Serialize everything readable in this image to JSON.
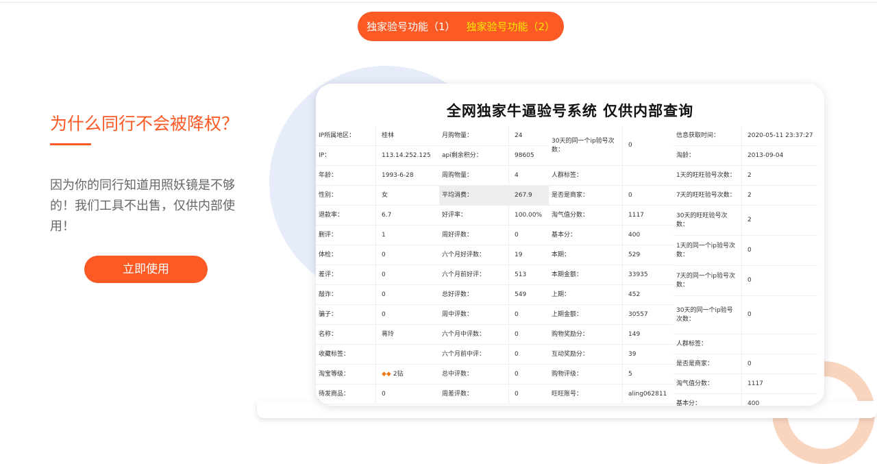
{
  "tabs": [
    {
      "label": "独家验号功能（1）"
    },
    {
      "label": "独家验号功能（2）"
    }
  ],
  "headline": "为什么同行不会被降权？",
  "description": "因为你的同行知道用照妖镜是不够的！我们工具不出售，仅供内部使用！",
  "cta": "立即使用",
  "card": {
    "title": "全网独家牛逼验号系统 仅供内部查询",
    "col1": [
      {
        "k": "IP所属地区：",
        "v": "桂林"
      },
      {
        "k": "IP：",
        "v": "113.14.252.125"
      },
      {
        "k": "年龄：",
        "v": "1993-6-28"
      },
      {
        "k": "性别：",
        "v": "女"
      },
      {
        "k": "退款率：",
        "v": "6.7"
      },
      {
        "k": "删评：",
        "v": "1"
      },
      {
        "k": "体检：",
        "v": "0"
      },
      {
        "k": "差评：",
        "v": "0"
      },
      {
        "k": "敲诈：",
        "v": "0"
      },
      {
        "k": "骗子：",
        "v": "0"
      },
      {
        "k": "名称：",
        "v": "蒋玲"
      },
      {
        "k": "收藏标签：",
        "v": ""
      },
      {
        "k": "淘宝等级：",
        "v": "2钻"
      },
      {
        "k": "待发商品：",
        "v": "0"
      }
    ],
    "col2": [
      {
        "k": "月购物量：",
        "v": "24"
      },
      {
        "k": "api剩余积分：",
        "v": "98605"
      },
      {
        "k": "周购物量：",
        "v": "4"
      },
      {
        "k": "平均消费：",
        "v": "267.9"
      },
      {
        "k": "好评率：",
        "v": "100.00%"
      },
      {
        "k": "周好评数：",
        "v": "0"
      },
      {
        "k": "六个月好评数：",
        "v": "19"
      },
      {
        "k": "六个月前好评：",
        "v": "513"
      },
      {
        "k": "总好评数：",
        "v": "549"
      },
      {
        "k": "周中评数：",
        "v": "0"
      },
      {
        "k": "六个月中评数：",
        "v": "0"
      },
      {
        "k": "六个月前中评：",
        "v": "0"
      },
      {
        "k": "总中评数：",
        "v": "0"
      },
      {
        "k": "周差评数：",
        "v": "0"
      }
    ],
    "col3": [
      {
        "k": "30天的同一个ip验号次数：",
        "v": "0"
      },
      {
        "k": "人群标签：",
        "v": ""
      },
      {
        "k": "是否是商家：",
        "v": "0"
      },
      {
        "k": "淘气值分数：",
        "v": "1117"
      },
      {
        "k": "基本分：",
        "v": "400"
      },
      {
        "k": "本期：",
        "v": "529"
      },
      {
        "k": "本期金额：",
        "v": "33935"
      },
      {
        "k": "上期：",
        "v": "452"
      },
      {
        "k": "上期金额：",
        "v": "30557"
      },
      {
        "k": "购物奖励分：",
        "v": "149"
      },
      {
        "k": "互动奖励分：",
        "v": "39"
      },
      {
        "k": "购物评级：",
        "v": "5"
      },
      {
        "k": "旺旺账号：",
        "v": "aling062811"
      }
    ],
    "col4": [
      {
        "k": "信息获取时间：",
        "v": "2020-05-11 23:37:27"
      },
      {
        "k": "淘龄：",
        "v": "2013-09-04"
      },
      {
        "k": "1天的旺旺验号次数：",
        "v": "2"
      },
      {
        "k": "7天的旺旺验号次数：",
        "v": "2"
      },
      {
        "k": "30天的旺旺验号次数：",
        "v": "2"
      },
      {
        "k": "1天的同一个ip验号次数：",
        "v": "0"
      },
      {
        "k": "7天的同一个ip验号次数：",
        "v": "0"
      },
      {
        "k": "30天的同一个ip验号次数：",
        "v": "0"
      },
      {
        "k": "人群标签：",
        "v": ""
      },
      {
        "k": "是否是商家：",
        "v": "0"
      },
      {
        "k": "淘气值分数：",
        "v": "1117"
      },
      {
        "k": "基本分：",
        "v": "400"
      }
    ]
  }
}
